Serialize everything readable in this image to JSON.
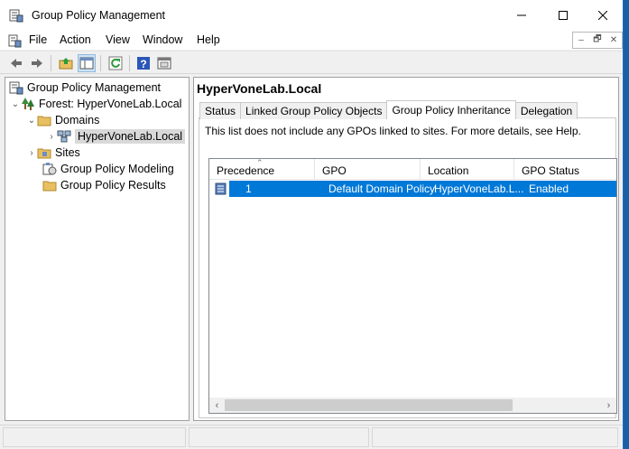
{
  "window": {
    "title": "Group Policy Management",
    "controls": {
      "minimize": "—",
      "maximize": "☐",
      "close": "✕"
    }
  },
  "menu": {
    "items": [
      "File",
      "Action",
      "View",
      "Window",
      "Help"
    ],
    "mdi": [
      "–",
      "🗗",
      "✕"
    ]
  },
  "toolbar": {
    "buttons": [
      "back-icon",
      "forward-icon",
      "up-folder-icon",
      "show-hide-tree-icon",
      "refresh-icon",
      "help-icon",
      "console-icon"
    ]
  },
  "tree": {
    "root": "Group Policy Management",
    "forest": "Forest: HyperVoneLab.Local",
    "domains": "Domains",
    "domain": "HyperVoneLab.Local",
    "sites": "Sites",
    "modeling": "Group Policy Modeling",
    "results": "Group Policy Results"
  },
  "details": {
    "title": "HyperVoneLab.Local",
    "tabs": [
      "Status",
      "Linked Group Policy Objects",
      "Group Policy Inheritance",
      "Delegation"
    ],
    "active_tab": "Group Policy Inheritance",
    "info": "This list does not include any GPOs linked to sites. For more details, see Help.",
    "columns": [
      "Precedence",
      "GPO",
      "Location",
      "GPO Status"
    ],
    "rows": [
      {
        "precedence": "1",
        "gpo": "Default Domain Policy",
        "location": "HyperVoneLab.L...",
        "status": "Enabled"
      }
    ]
  },
  "colors": {
    "selection": "#0078d7",
    "desktop_accent": "#1b5fa8"
  }
}
